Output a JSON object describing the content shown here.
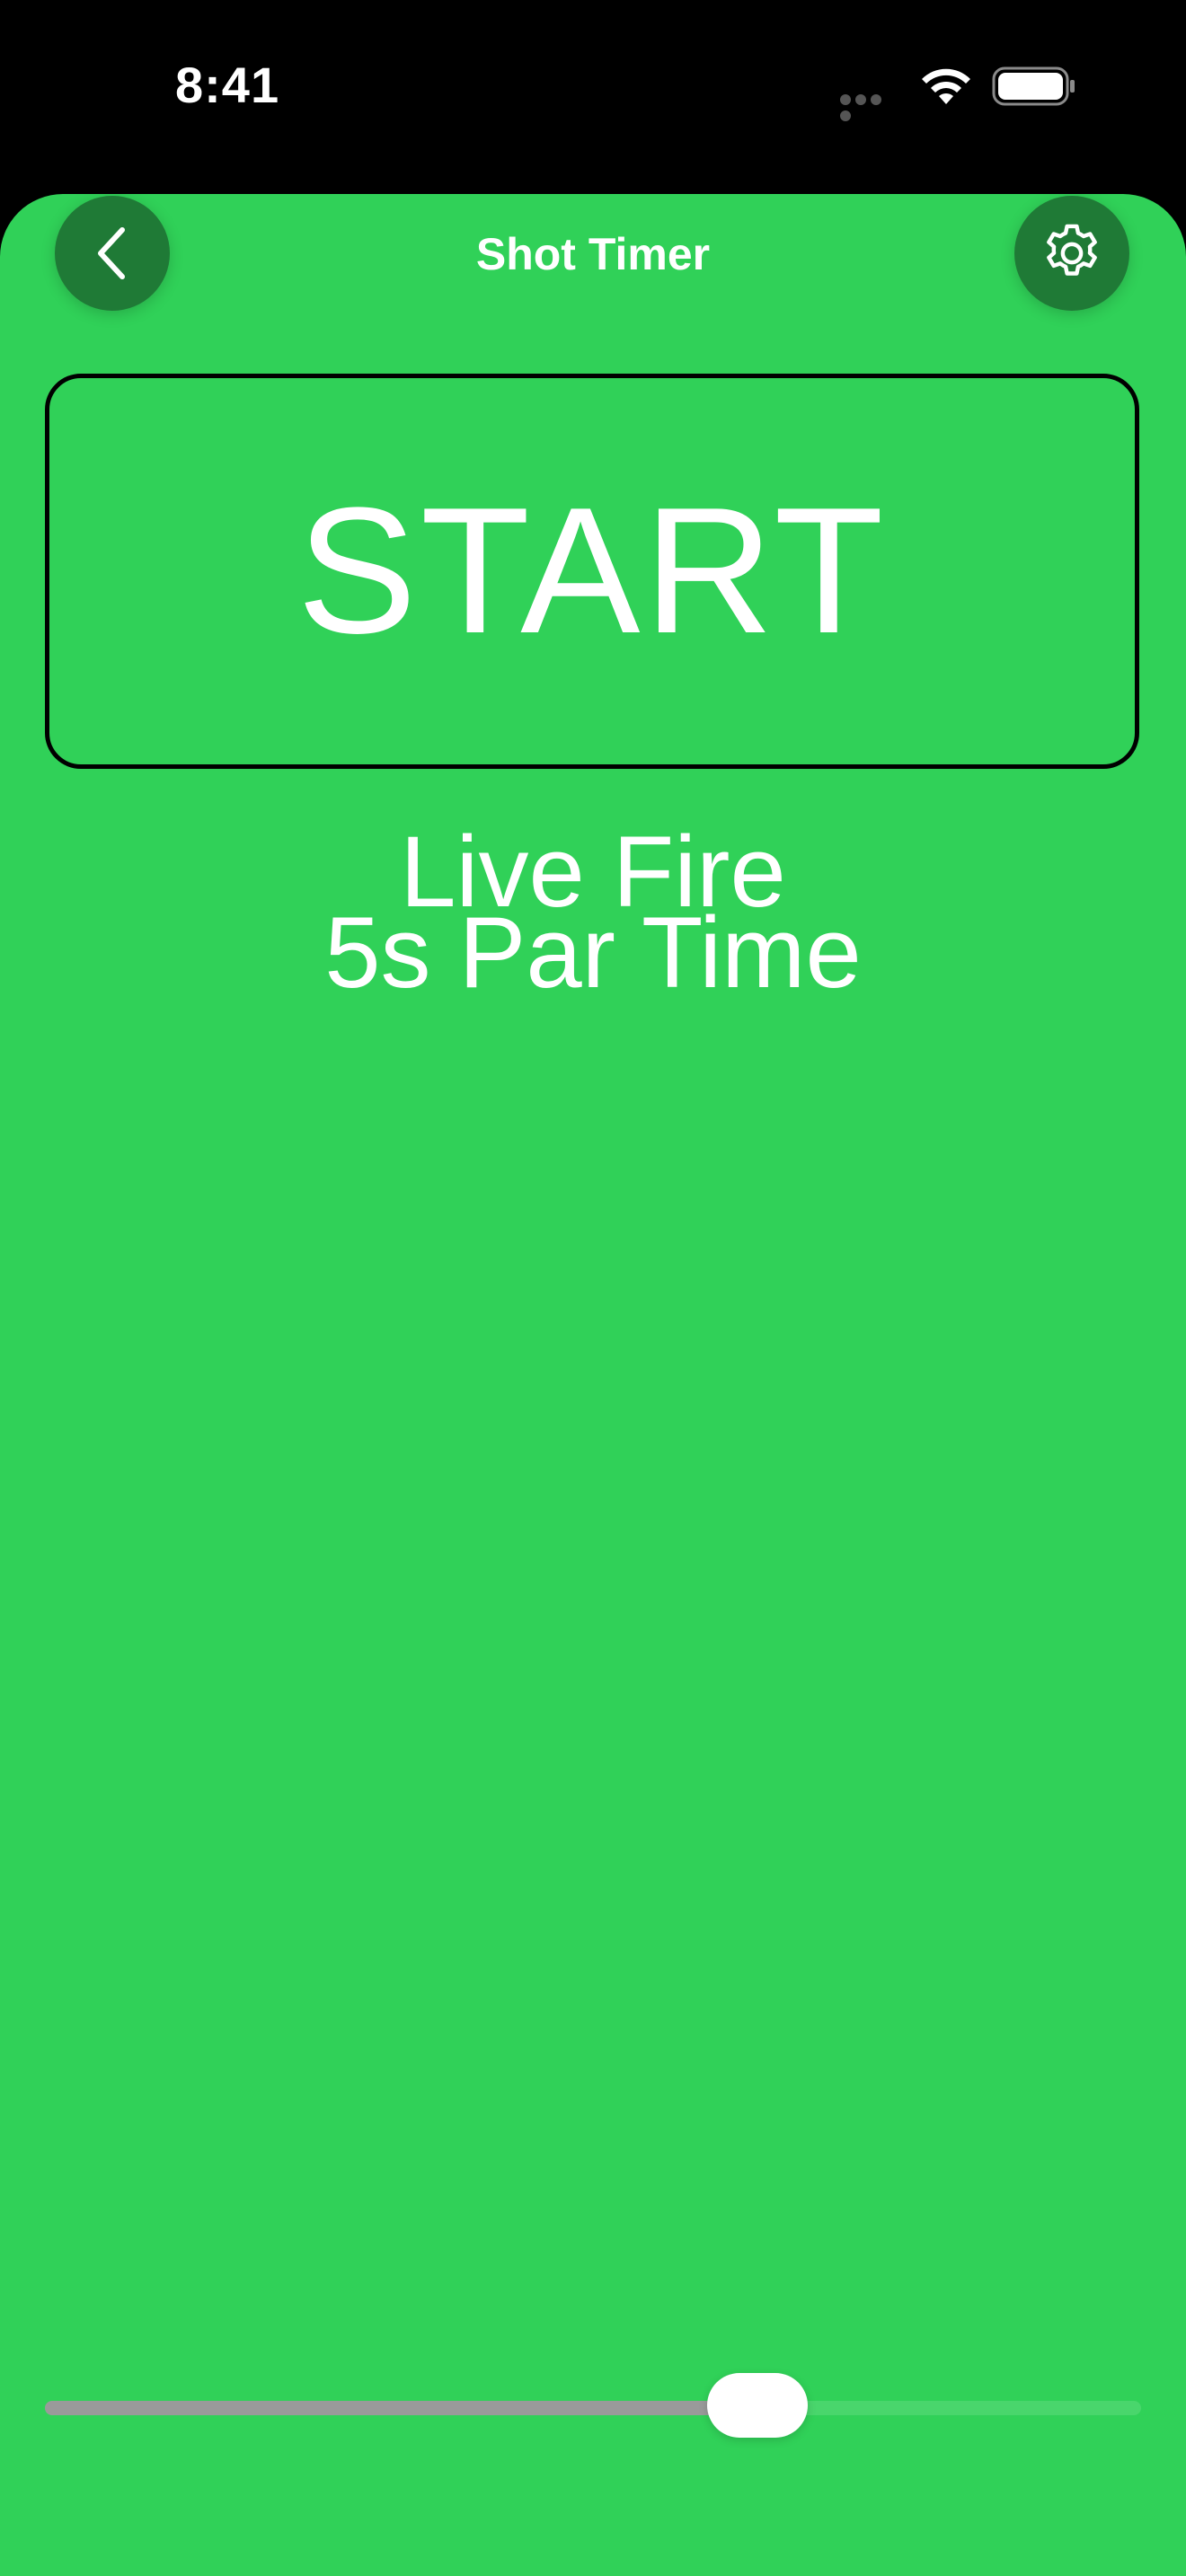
{
  "status_bar": {
    "time": "8:41"
  },
  "nav": {
    "title": "Shot Timer",
    "back_icon": "chevron-left-icon",
    "settings_icon": "gear-icon"
  },
  "main": {
    "start_label": "START",
    "mode_label": "Live Fire",
    "par_time_label": "5s Par Time"
  },
  "slider": {
    "value_fraction": 0.65
  },
  "colors": {
    "background": "#30d158",
    "nav_button": "#1f7a36",
    "text": "#ffffff"
  }
}
